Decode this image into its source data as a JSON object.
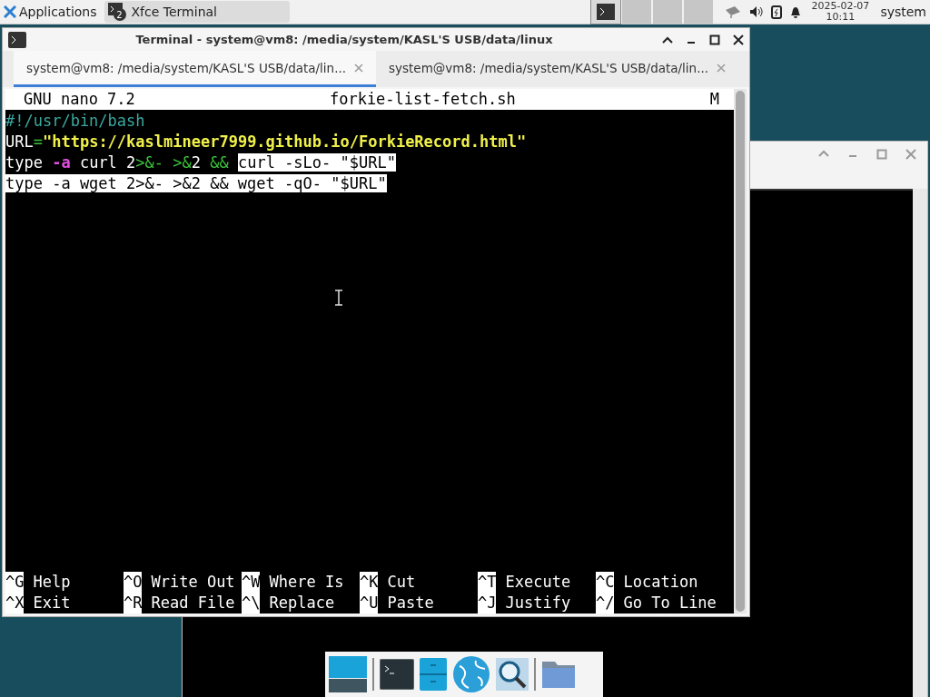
{
  "panel": {
    "menu_label": "Applications",
    "task": {
      "label": "Xfce Terminal",
      "badge": "2"
    },
    "workspaces": [
      {
        "selected": true
      },
      {
        "selected": false
      },
      {
        "selected": false
      },
      {
        "selected": false
      }
    ],
    "clock": {
      "date": "2025-02-07",
      "time": "10:11"
    },
    "user": "system"
  },
  "window": {
    "title": "Terminal - system@vm8: /media/system/KASL'S USB/data/linux",
    "tabs": [
      {
        "label": "system@vm8: /media/system/KASL'S USB/data/lin...",
        "selected": true
      },
      {
        "label": "system@vm8: /media/system/KASL'S USB/data/lin...",
        "selected": false
      }
    ],
    "nano": {
      "version": "GNU nano 7.2",
      "filename": "forkie-list-fetch.sh",
      "modified": "M",
      "lines": [
        [
          {
            "text": "#!/usr/bin/bash",
            "kind": "comment"
          }
        ],
        [
          {
            "text": "URL",
            "kind": "plain"
          },
          {
            "text": "=",
            "kind": "operator"
          },
          {
            "text": "\"https://kaslmineer7999.github.io/ForkieRecord.html\"",
            "kind": "string"
          }
        ],
        [
          {
            "text": "type ",
            "kind": "plain"
          },
          {
            "text": "-a",
            "kind": "flag"
          },
          {
            "text": " curl 2",
            "kind": "plain"
          },
          {
            "text": ">&- >&",
            "kind": "operator"
          },
          {
            "text": "2 ",
            "kind": "plain"
          },
          {
            "text": "&& ",
            "kind": "operator"
          },
          {
            "text": "curl -sLo- \"$URL\"",
            "kind": "selected"
          }
        ],
        [
          {
            "text": "type -a wget 2>&- >&2 && wget -qO- \"$URL\"",
            "kind": "selected"
          }
        ]
      ],
      "shortcuts": [
        [
          {
            "key": "^G",
            "label": "Help"
          },
          {
            "key": "^O",
            "label": "Write Out"
          },
          {
            "key": "^W",
            "label": "Where Is"
          },
          {
            "key": "^K",
            "label": "Cut"
          },
          {
            "key": "^T",
            "label": "Execute"
          },
          {
            "key": "^C",
            "label": "Location"
          }
        ],
        [
          {
            "key": "^X",
            "label": "Exit"
          },
          {
            "key": "^R",
            "label": "Read File"
          },
          {
            "key": "^\\",
            "label": "Replace"
          },
          {
            "key": "^U",
            "label": "Paste"
          },
          {
            "key": "^J",
            "label": "Justify"
          },
          {
            "key": "^/",
            "label": "Go To Line"
          }
        ]
      ]
    }
  }
}
